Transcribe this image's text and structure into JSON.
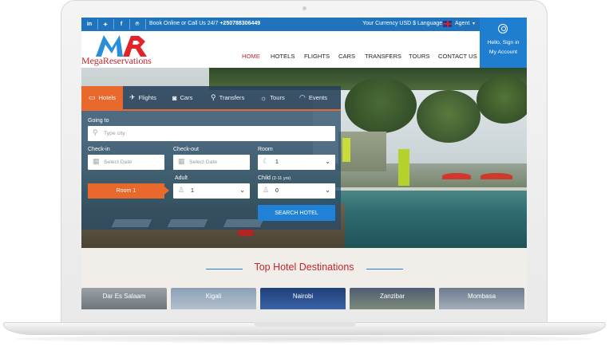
{
  "topbar": {
    "social": [
      {
        "icon": "linkedin-icon",
        "glyph": "in"
      },
      {
        "icon": "twitter-icon",
        "glyph": "✦"
      },
      {
        "icon": "facebook-icon",
        "glyph": "f"
      },
      {
        "icon": "pinterest-icon",
        "glyph": "℗"
      }
    ],
    "call_text": "Book Online or Call Us 24/7",
    "phone": "+250788306449",
    "currency": "Your Currency USD $",
    "language": "Language",
    "agent": "Agent",
    "agent_caret": "▾"
  },
  "header": {
    "logo_text": "MegaReservations",
    "nav": [
      "HOME",
      "HOTELS",
      "FLIGHTS",
      "CARS",
      "TRANSFERS",
      "TOURS",
      "CONTACT US"
    ],
    "account_line1": "Hello, Sign in",
    "account_line2": "My Account"
  },
  "search": {
    "tabs": [
      {
        "label": "Hotels",
        "glyph": "▭",
        "icon": "bed-icon"
      },
      {
        "label": "Flights",
        "glyph": "✈",
        "icon": "plane-icon"
      },
      {
        "label": "Cars",
        "glyph": "◙",
        "icon": "car-icon"
      },
      {
        "label": "Transfers",
        "glyph": "⚲",
        "icon": "person-icon"
      },
      {
        "label": "Tours",
        "glyph": "☼",
        "icon": "tour-icon"
      },
      {
        "label": "Events",
        "glyph": "◠",
        "icon": "events-icon"
      }
    ],
    "going_to_label": "Going to",
    "going_to_placeholder": "Type city",
    "checkin_label": "Check-in",
    "checkin_placeholder": "Select Date",
    "checkout_label": "Check-out",
    "checkout_placeholder": "Select Date",
    "room_label": "Room",
    "room_value": "1",
    "adult_label": "Adult",
    "adult_value": "1",
    "child_label": "Child",
    "child_age_note": "(2-11 yrs)",
    "child_value": "0",
    "room_button": "Room 1",
    "search_button": "SEARCH HOTEL"
  },
  "destinations": {
    "title": "Top Hotel Destinations",
    "cities": [
      "Dar Es Salaam",
      "Kigali",
      "Nairobi",
      "Zanzibar",
      "Mombasa"
    ]
  },
  "colors": {
    "primary_blue": "#1f74bd",
    "accent_orange": "#e9692c",
    "brand_red": "#c0262d"
  }
}
